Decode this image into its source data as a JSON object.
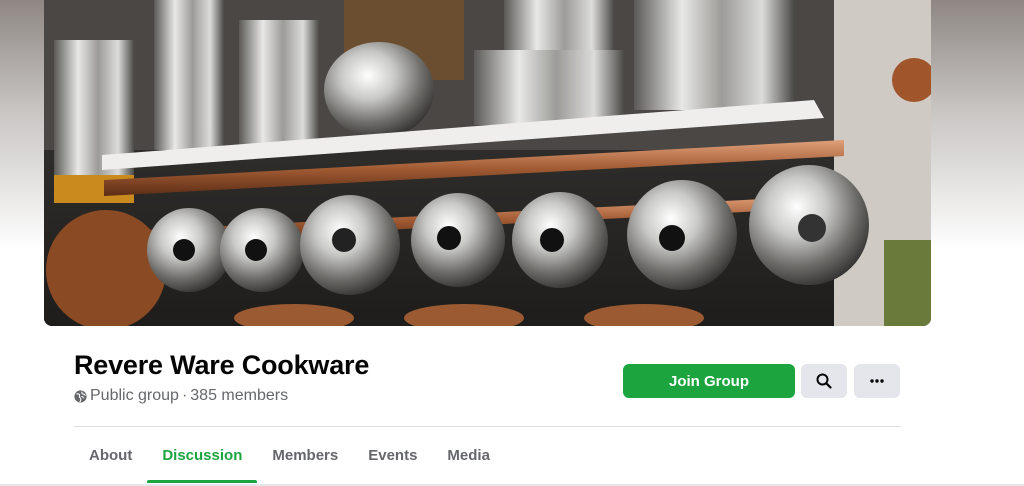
{
  "group": {
    "name": "Revere Ware Cookware",
    "privacy": "Public group",
    "separator": "·",
    "members": "385 members"
  },
  "actions": {
    "join_label": "Join Group",
    "search_icon": "search-icon",
    "more_icon": "more-icon"
  },
  "tabs": [
    {
      "label": "About",
      "active": false
    },
    {
      "label": "Discussion",
      "active": true
    },
    {
      "label": "Members",
      "active": false
    },
    {
      "label": "Events",
      "active": false
    },
    {
      "label": "Media",
      "active": false
    }
  ],
  "colors": {
    "accent": "#1ca53f",
    "text_secondary": "#65676b",
    "button_gray": "#e4e6eb"
  }
}
